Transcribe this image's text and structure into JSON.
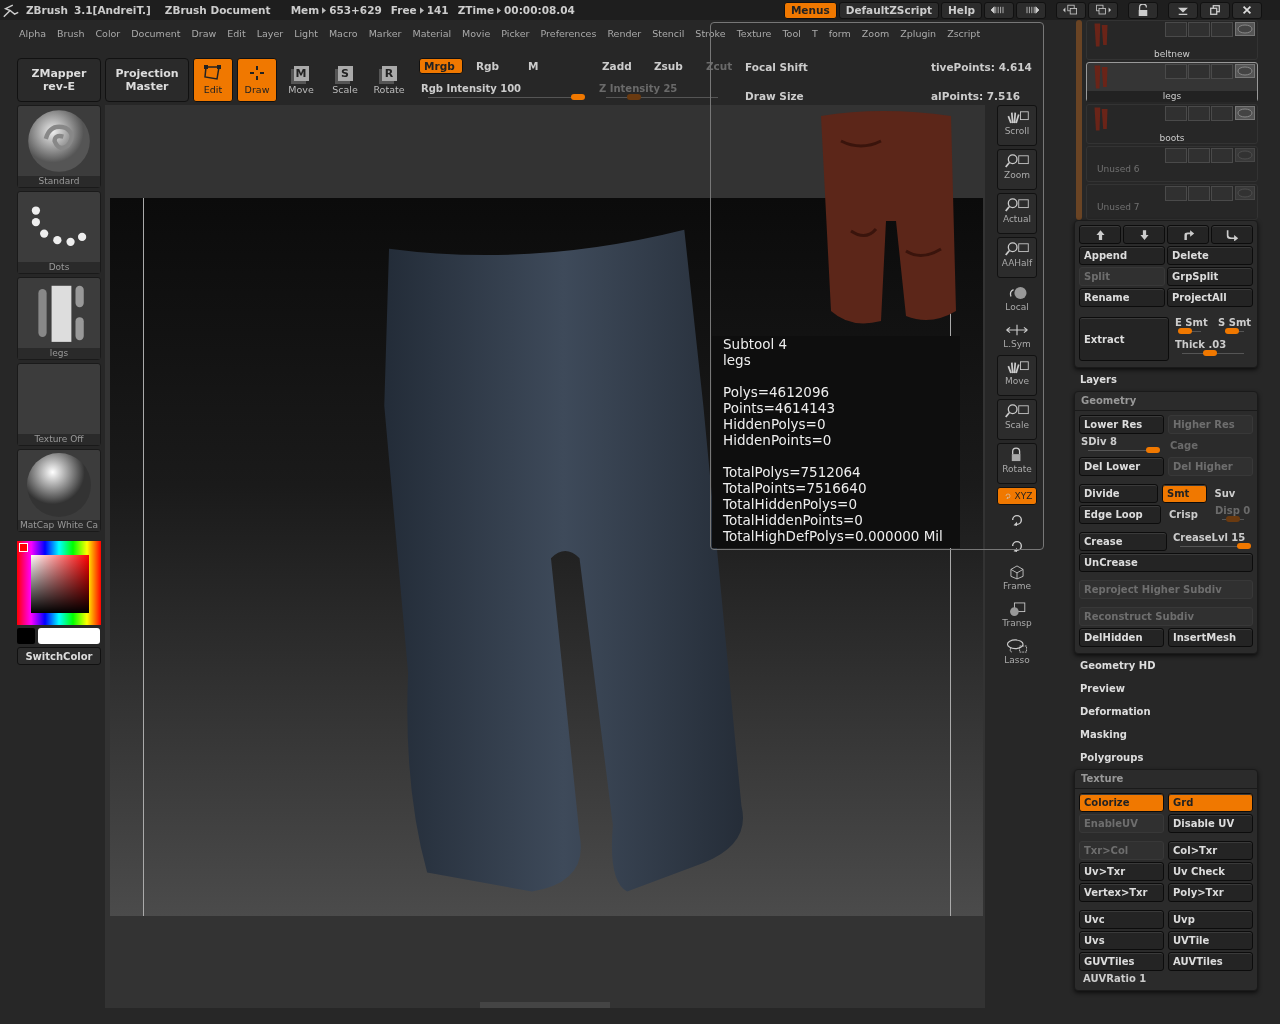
{
  "title_bar": {
    "app": "ZBrush",
    "version": "3.1[AndreiT.]",
    "document": "ZBrush Document",
    "stats": [
      {
        "label": "Mem",
        "value": "653+629"
      },
      {
        "label": "Free",
        "value": "141"
      },
      {
        "label": "ZTime",
        "value": "00:00:08.04"
      }
    ],
    "buttons": [
      {
        "label": "Menus",
        "selected": true
      },
      {
        "label": "DefaultZScript",
        "selected": false
      },
      {
        "label": "Help",
        "selected": false
      }
    ]
  },
  "menu_bar": [
    "Alpha",
    "Brush",
    "Color",
    "Document",
    "Draw",
    "Edit",
    "Layer",
    "Light",
    "Macro",
    "Marker",
    "Material",
    "Movie",
    "Picker",
    "Preferences",
    "Render",
    "Stencil",
    "Stroke",
    "Texture",
    "Tool",
    "T",
    "form",
    "Zoom",
    "Zplugin",
    "Zscript"
  ],
  "toolbar": {
    "mapper": {
      "label": "ZMapper",
      "sub": "rev-E"
    },
    "projection": {
      "label": "Projection",
      "sub": "Master"
    },
    "modes": [
      {
        "kind": "edit",
        "label": "Edit",
        "on": true
      },
      {
        "kind": "draw",
        "label": "Draw",
        "on": true
      },
      {
        "kind": "move",
        "key": "M",
        "label": "Move",
        "on": false
      },
      {
        "kind": "scale",
        "key": "S",
        "label": "Scale",
        "on": false
      },
      {
        "kind": "rotate",
        "key": "R",
        "label": "Rotate",
        "on": false
      }
    ],
    "color_modes": [
      {
        "label": "Mrgb",
        "on": true
      },
      {
        "label": "Rgb",
        "on": false
      },
      {
        "label": "M",
        "on": false
      }
    ],
    "rgb_intensity": {
      "label": "Rgb Intensity",
      "value": "100",
      "level": 1,
      "disabled": false
    },
    "z_modes": [
      {
        "label": "Zadd",
        "on": false,
        "disabled": false
      },
      {
        "label": "Zsub",
        "on": false,
        "disabled": false
      },
      {
        "label": "Zcut",
        "on": false,
        "disabled": true
      }
    ],
    "z_intensity": {
      "label": "Z Intensity",
      "value": "25",
      "level": 0.25,
      "disabled": true
    },
    "focal_shift": "Focal Shift",
    "draw_size": "Draw Size",
    "active_points": "tivePoints: 4.614",
    "total_points": "alPoints: 7.516"
  },
  "shelf": {
    "thumbs": [
      {
        "kind": "brush",
        "label": "Standard"
      },
      {
        "kind": "stroke",
        "label": "Dots"
      },
      {
        "kind": "alpha",
        "label": "legs"
      },
      {
        "kind": "texture",
        "label": "Texture Off"
      },
      {
        "kind": "material",
        "label": "MatCap White Ca"
      }
    ],
    "switch_color": "SwitchColor"
  },
  "popup": {
    "title": "Subtool 4",
    "name": "legs",
    "stats": [
      [
        "Polys=4612096",
        "Points=4614143",
        "HiddenPolys=0",
        "HiddenPoints=0"
      ],
      [
        "TotalPolys=7512064",
        "TotalPoints=7516640",
        "TotalHiddenPolys=0",
        "TotalHiddenPoints=0",
        "TotalHighDefPolys=0.000000 Mil"
      ]
    ]
  },
  "nav_tools": [
    {
      "kind": "scroll",
      "label": "Scroll",
      "boxed": true,
      "on": false
    },
    {
      "kind": "zoom",
      "label": "Zoom",
      "boxed": true,
      "on": false
    },
    {
      "kind": "actual",
      "label": "Actual",
      "boxed": true,
      "on": false
    },
    {
      "kind": "aahalf",
      "label": "AAHalf",
      "boxed": true,
      "on": false
    },
    {
      "kind": "local",
      "label": "Local",
      "boxed": false,
      "on": false
    },
    {
      "kind": "lsym",
      "label": "L.Sym",
      "boxed": false,
      "on": false
    },
    {
      "kind": "move",
      "label": "Move",
      "boxed": true,
      "on": false
    },
    {
      "kind": "scale",
      "label": "Scale",
      "boxed": true,
      "on": false
    },
    {
      "kind": "rotate",
      "label": "Rotate",
      "boxed": true,
      "on": false
    },
    {
      "kind": "xyz",
      "label": "XYZ",
      "boxed": true,
      "on": true
    },
    {
      "kind": "roty",
      "boxed": false,
      "on": false
    },
    {
      "kind": "rotz",
      "boxed": false,
      "on": false
    },
    {
      "kind": "frame",
      "label": "Frame",
      "boxed": false,
      "on": false
    },
    {
      "kind": "transp",
      "label": "Transp",
      "boxed": false,
      "on": false
    },
    {
      "kind": "lasso",
      "label": "Lasso",
      "boxed": false,
      "on": false
    }
  ],
  "subtools": {
    "items": [
      {
        "name": "beltnew",
        "selected": false,
        "empty": false
      },
      {
        "name": "legs",
        "selected": true,
        "empty": false
      },
      {
        "name": "boots",
        "selected": false,
        "empty": false
      },
      {
        "name": "Unused 6",
        "selected": false,
        "empty": true
      },
      {
        "name": "Unused 7",
        "selected": false,
        "empty": true
      }
    ],
    "arrows": [
      {
        "kind": "up"
      },
      {
        "kind": "down"
      },
      {
        "kind": "curve-up"
      },
      {
        "kind": "curve-down"
      }
    ],
    "buttons": [
      {
        "label": "Append",
        "disabled": false
      },
      {
        "label": "Delete",
        "disabled": false
      },
      {
        "label": "Split",
        "disabled": true
      },
      {
        "label": "GrpSplit",
        "disabled": false
      },
      {
        "label": "Rename",
        "disabled": false
      },
      {
        "label": "ProjectAll",
        "disabled": false
      }
    ],
    "extract": "Extract",
    "sliders": [
      {
        "label": "E Smt",
        "level": 0.15
      },
      {
        "label": "S Smt",
        "level": 0.35
      },
      {
        "label": "Thick .03",
        "level": 0.45
      }
    ]
  },
  "sections": [
    {
      "title": "Layers",
      "expanded": false
    },
    {
      "title": "Geometry",
      "expanded": true,
      "groups": [
        [
          [
            {
              "kind": "button",
              "label": "Lower Res",
              "on": false,
              "disabled": false
            },
            {
              "kind": "button",
              "label": "Higher Res",
              "on": false,
              "disabled": true
            }
          ],
          [
            {
              "kind": "slider",
              "label": "SDiv 8",
              "level": 1,
              "disabled": false
            },
            {
              "kind": "toggle",
              "label": "Cage",
              "on": false,
              "disabled": true
            }
          ],
          [
            {
              "kind": "button",
              "label": "Del Lower",
              "on": false,
              "disabled": false
            },
            {
              "kind": "button",
              "label": "Del Higher",
              "on": false,
              "disabled": true
            }
          ]
        ],
        [
          [
            {
              "kind": "button",
              "label": "Divide",
              "on": false,
              "disabled": false
            },
            {
              "kind": "button",
              "label": "Smt",
              "on": true,
              "disabled": false
            },
            {
              "kind": "toggle",
              "label": "Suv",
              "on": false,
              "disabled": false
            }
          ],
          [
            {
              "kind": "button",
              "label": "Edge Loop",
              "on": false,
              "disabled": false
            },
            {
              "kind": "toggle",
              "label": "Crisp",
              "on": false,
              "disabled": false
            },
            {
              "kind": "slider",
              "label": "Disp 0",
              "level": 0.5,
              "disabled": true
            }
          ]
        ],
        [
          [
            {
              "kind": "button",
              "label": "Crease",
              "on": false,
              "disabled": false
            },
            {
              "kind": "slider",
              "label": "CreaseLvl 15",
              "level": 1,
              "disabled": false
            }
          ],
          [
            {
              "kind": "button",
              "label": "UnCrease",
              "on": false,
              "disabled": false
            }
          ]
        ],
        [
          [
            {
              "kind": "button",
              "label": "Reproject Higher Subdiv",
              "on": false,
              "disabled": true
            }
          ]
        ],
        [
          [
            {
              "kind": "button",
              "label": "Reconstruct Subdiv",
              "on": false,
              "disabled": true
            }
          ],
          [
            {
              "kind": "button",
              "label": "DelHidden",
              "on": false,
              "disabled": false
            },
            {
              "kind": "button",
              "label": "InsertMesh",
              "on": false,
              "disabled": false
            }
          ]
        ]
      ]
    },
    {
      "title": "Geometry HD",
      "expanded": false
    },
    {
      "title": "Preview",
      "expanded": false
    },
    {
      "title": "Deformation",
      "expanded": false
    },
    {
      "title": "Masking",
      "expanded": false
    },
    {
      "title": "Polygroups",
      "expanded": false
    },
    {
      "title": "Texture",
      "expanded": true,
      "groups": [
        [
          [
            {
              "kind": "button",
              "label": "Colorize",
              "on": true,
              "disabled": false
            },
            {
              "kind": "button",
              "label": "Grd",
              "on": true,
              "disabled": false
            }
          ],
          [
            {
              "kind": "button",
              "label": "EnableUV",
              "on": false,
              "disabled": true
            },
            {
              "kind": "button",
              "label": "Disable UV",
              "on": false,
              "disabled": false
            }
          ]
        ],
        [
          [
            {
              "kind": "button",
              "label": "Txr>Col",
              "on": false,
              "disabled": true
            },
            {
              "kind": "button",
              "label": "Col>Txr",
              "on": false,
              "disabled": false
            }
          ],
          [
            {
              "kind": "button",
              "label": "Uv>Txr",
              "on": false,
              "disabled": false
            },
            {
              "kind": "button",
              "label": "Uv Check",
              "on": false,
              "disabled": false
            }
          ],
          [
            {
              "kind": "button",
              "label": "Vertex>Txr",
              "on": false,
              "disabled": false
            },
            {
              "kind": "button",
              "label": "Poly>Txr",
              "on": false,
              "disabled": false
            }
          ]
        ],
        [
          [
            {
              "kind": "button",
              "label": "Uvc",
              "on": false,
              "disabled": false
            },
            {
              "kind": "button",
              "label": "Uvp",
              "on": false,
              "disabled": false
            }
          ],
          [
            {
              "kind": "button",
              "label": "Uvs",
              "on": false,
              "disabled": false
            },
            {
              "kind": "button",
              "label": "UVTile",
              "on": false,
              "disabled": false
            }
          ],
          [
            {
              "kind": "button",
              "label": "GUVTiles",
              "on": false,
              "disabled": false
            },
            {
              "kind": "button",
              "label": "AUVTiles",
              "on": false,
              "disabled": false
            }
          ],
          [
            {
              "kind": "label",
              "label": "AUVRatio 1",
              "disabled": false
            }
          ]
        ]
      ]
    }
  ]
}
